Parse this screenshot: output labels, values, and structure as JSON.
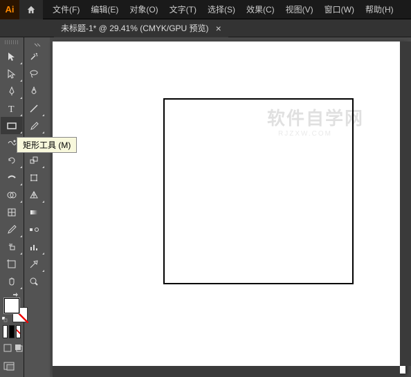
{
  "app": {
    "logo": "Ai"
  },
  "menu": [
    "文件(F)",
    "编辑(E)",
    "对象(O)",
    "文字(T)",
    "选择(S)",
    "效果(C)",
    "视图(V)",
    "窗口(W)",
    "帮助(H)"
  ],
  "document": {
    "tab_label": "未标题-1* @ 29.41% (CMYK/GPU 预览)",
    "close": "×"
  },
  "tooltip": "矩形工具 (M)",
  "watermark": {
    "main": "软件自学网",
    "sub": "RJZXW.COM"
  },
  "tools": {
    "rows": [
      [
        "selection",
        "magic-wand"
      ],
      [
        "direct-selection",
        "lasso"
      ],
      [
        "pen",
        "curvature"
      ],
      [
        "type",
        "line-segment"
      ],
      [
        "rectangle",
        "paintbrush"
      ],
      [
        "shaper",
        "eraser"
      ],
      [
        "rotate",
        "scale"
      ],
      [
        "width",
        "free-transform"
      ],
      [
        "shape-builder",
        "perspective"
      ],
      [
        "mesh",
        "gradient"
      ],
      [
        "eyedropper",
        "blend"
      ],
      [
        "symbol-sprayer",
        "column-graph"
      ],
      [
        "artboard",
        "slice"
      ],
      [
        "hand",
        "zoom"
      ]
    ],
    "selected": "rectangle"
  }
}
